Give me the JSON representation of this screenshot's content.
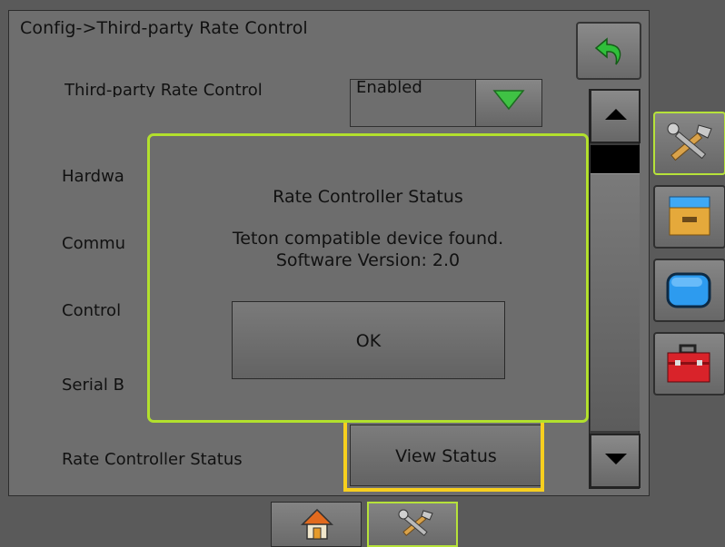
{
  "header": {
    "title": "Config->Third-party Rate Control"
  },
  "rows": [
    {
      "label": "Third-party Rate Control",
      "value": "Enabled"
    },
    {
      "label": "Hardwa"
    },
    {
      "label": "Commu"
    },
    {
      "label": "Control"
    },
    {
      "label": "Serial B"
    },
    {
      "label": "Rate Controller Status",
      "button": "View Status"
    }
  ],
  "dialog": {
    "title": "Rate Controller Status",
    "message_line1": "Teton compatible device found.",
    "message_line2": "Software Version: 2.0",
    "ok_label": "OK"
  },
  "rail": [
    {
      "icon": "tools-icon",
      "active": true
    },
    {
      "icon": "file-drawer-icon"
    },
    {
      "icon": "display-icon"
    },
    {
      "icon": "toolbox-icon"
    }
  ],
  "bottom_tabs": [
    {
      "icon": "home-icon"
    },
    {
      "icon": "tools-icon",
      "active": true
    }
  ],
  "colors": {
    "accent": "#b2e02d",
    "highlight": "#f7cf1e"
  }
}
